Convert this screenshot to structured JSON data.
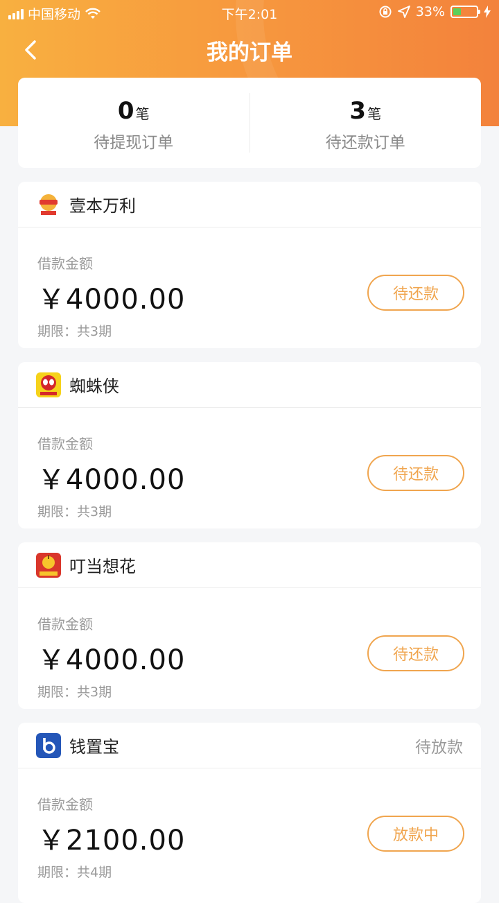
{
  "status_bar": {
    "carrier": "中国移动",
    "time": "下午2:01",
    "battery": "33%"
  },
  "nav": {
    "title": "我的订单"
  },
  "summary": [
    {
      "count": "0",
      "unit": "笔",
      "label": "待提现订单"
    },
    {
      "count": "3",
      "unit": "笔",
      "label": "待还款订单"
    }
  ],
  "orders": [
    {
      "name": "壹本万利",
      "status": "",
      "amount_label": "借款金额",
      "amount": "￥4000.00",
      "term": "期限：共3期",
      "button": "待还款"
    },
    {
      "name": "蜘蛛侠",
      "status": "",
      "amount_label": "借款金额",
      "amount": "￥4000.00",
      "term": "期限：共3期",
      "button": "待还款"
    },
    {
      "name": "叮当想花",
      "status": "",
      "amount_label": "借款金额",
      "amount": "￥4000.00",
      "term": "期限：共3期",
      "button": "待还款"
    },
    {
      "name": "钱置宝",
      "status": "待放款",
      "amount_label": "借款金额",
      "amount": "￥2100.00",
      "term": "期限：共4期",
      "button": "放款中"
    }
  ],
  "colors": {
    "header_start": "#f8b040",
    "header_end": "#f3823c",
    "accent": "#f0a54e",
    "background": "#f5f6f8"
  },
  "icons": {
    "back": "chevron-left-icon",
    "wifi": "wifi-icon",
    "location": "location-arrow-icon",
    "lock": "rotation-lock-icon",
    "charging": "bolt-icon"
  }
}
